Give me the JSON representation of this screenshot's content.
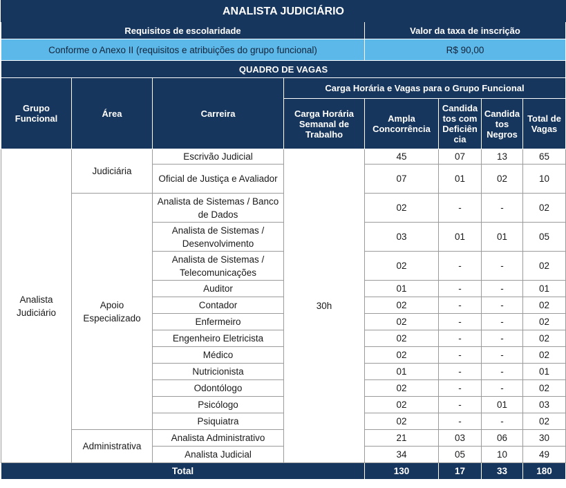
{
  "title": "ANALISTA JUDICIÁRIO",
  "header": {
    "requisitos_label": "Requisitos de escolaridade",
    "taxa_label": "Valor da taxa de inscrição",
    "requisitos_value": "Conforme o Anexo II (requisitos e atribuições do grupo funcional)",
    "taxa_value": "R$ 90,00"
  },
  "quadro_title": "QUADRO DE VAGAS",
  "columns": {
    "grupo": "Grupo Funcional",
    "area": "Área",
    "carreira": "Carreira",
    "carga_group": "Carga Horária e Vagas para o Grupo Funcional",
    "carga_semanal": "Carga Horária Semanal de Trabalho",
    "ampla": "Ampla Concorrência",
    "deficiencia": "Candida tos com Deficiên cia",
    "negros": "Candida tos Negros",
    "total": "Total de Vagas"
  },
  "grupo_value": "Analista Judiciário",
  "carga_value": "30h",
  "areas": [
    "Judiciária",
    "Apoio Especializado",
    "Administrativa"
  ],
  "rows": [
    {
      "carreira": "Escrivão Judicial",
      "ampla": "45",
      "def": "07",
      "neg": "13",
      "total": "65"
    },
    {
      "carreira": "Oficial de Justiça e Avaliador",
      "ampla": "07",
      "def": "01",
      "neg": "02",
      "total": "10"
    },
    {
      "carreira": "Analista de Sistemas / Banco de Dados",
      "ampla": "02",
      "def": "-",
      "neg": "-",
      "total": "02"
    },
    {
      "carreira": "Analista de Sistemas / Desenvolvimento",
      "ampla": "03",
      "def": "01",
      "neg": "01",
      "total": "05"
    },
    {
      "carreira": "Analista de Sistemas / Telecomunicações",
      "ampla": "02",
      "def": "-",
      "neg": "-",
      "total": "02"
    },
    {
      "carreira": "Auditor",
      "ampla": "01",
      "def": "-",
      "neg": "-",
      "total": "01"
    },
    {
      "carreira": "Contador",
      "ampla": "02",
      "def": "-",
      "neg": "-",
      "total": "02"
    },
    {
      "carreira": "Enfermeiro",
      "ampla": "02",
      "def": "-",
      "neg": "-",
      "total": "02"
    },
    {
      "carreira": "Engenheiro Eletricista",
      "ampla": "02",
      "def": "-",
      "neg": "-",
      "total": "02"
    },
    {
      "carreira": "Médico",
      "ampla": "02",
      "def": "-",
      "neg": "-",
      "total": "02"
    },
    {
      "carreira": "Nutricionista",
      "ampla": "01",
      "def": "-",
      "neg": "-",
      "total": "01"
    },
    {
      "carreira": "Odontólogo",
      "ampla": "02",
      "def": "-",
      "neg": "-",
      "total": "02"
    },
    {
      "carreira": "Psicólogo",
      "ampla": "02",
      "def": "-",
      "neg": "01",
      "total": "03"
    },
    {
      "carreira": "Psiquiatra",
      "ampla": "02",
      "def": "-",
      "neg": "-",
      "total": "02"
    },
    {
      "carreira": "Analista Administrativo",
      "ampla": "21",
      "def": "03",
      "neg": "06",
      "total": "30"
    },
    {
      "carreira": "Analista Judicial",
      "ampla": "34",
      "def": "05",
      "neg": "10",
      "total": "49"
    }
  ],
  "totals": {
    "label": "Total",
    "ampla": "130",
    "def": "17",
    "neg": "33",
    "total": "180"
  }
}
